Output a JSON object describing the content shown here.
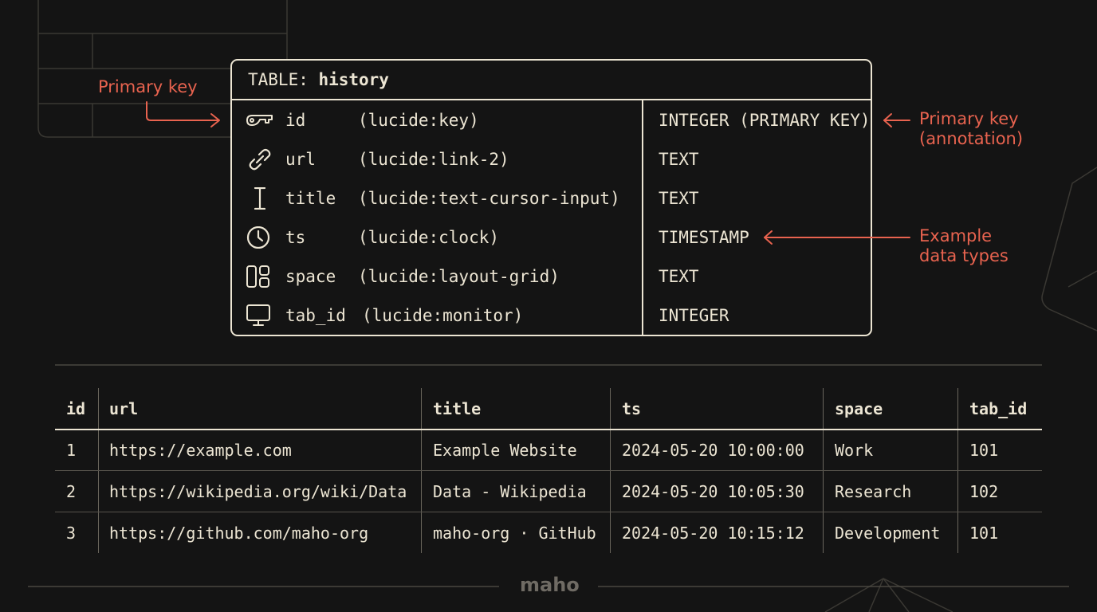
{
  "schema": {
    "title_prefix": "TABLE:",
    "table_name": "history",
    "columns": [
      {
        "name": "id",
        "icon_ref": "(lucide:key)",
        "type": "INTEGER (PRIMARY KEY)",
        "icon": "key-icon"
      },
      {
        "name": "url",
        "icon_ref": "(lucide:link-2)",
        "type": "TEXT",
        "icon": "link-icon"
      },
      {
        "name": "title",
        "icon_ref": "(lucide:text-cursor-input)",
        "type": "TEXT",
        "icon": "text-cursor-icon"
      },
      {
        "name": "ts",
        "icon_ref": "(lucide:clock)",
        "type": "TIMESTAMP",
        "icon": "clock-icon"
      },
      {
        "name": "space",
        "icon_ref": "(lucide:layout-grid)",
        "type": "TEXT",
        "icon": "layout-grid-icon"
      },
      {
        "name": "tab_id",
        "icon_ref": "(lucide:monitor)",
        "type": "INTEGER",
        "icon": "monitor-icon"
      }
    ]
  },
  "annotations": {
    "left_primary_key": "Primary key",
    "right_primary_key_line1": "Primary key",
    "right_primary_key_line2": "(annotation)",
    "example_types_line1": "Example",
    "example_types_line2": "data types"
  },
  "data_table": {
    "headers": [
      "id",
      "url",
      "title",
      "ts",
      "space",
      "tab_id"
    ],
    "rows": [
      [
        "1",
        "https://example.com",
        "Example Website",
        "2024-05-20 10:00:00",
        "Work",
        "101"
      ],
      [
        "2",
        "https://wikipedia.org/wiki/Data",
        "Data - Wikipedia",
        "2024-05-20 10:05:30",
        "Research",
        "102"
      ],
      [
        "3",
        "https://github.com/maho-org",
        "maho-org · GitHub",
        "2024-05-20 10:15:12",
        "Development",
        "101"
      ]
    ]
  },
  "footer": {
    "logo": "maho"
  },
  "colors": {
    "background": "#141414",
    "foreground": "#ece5d3",
    "accent": "#e8634f",
    "muted": "#6f6b64"
  }
}
